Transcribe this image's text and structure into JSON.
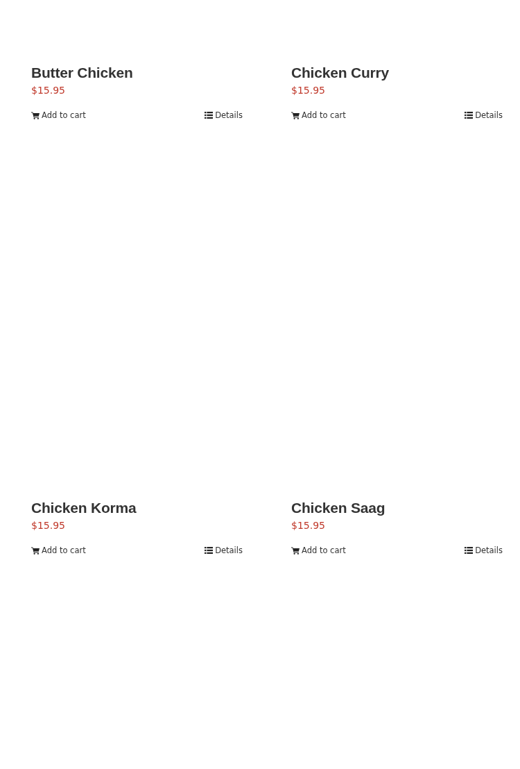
{
  "products": [
    {
      "name": "Butter Chicken",
      "price": "$15.95",
      "add_to_cart": "Add to cart",
      "details": "Details"
    },
    {
      "name": "Chicken Curry",
      "price": "$15.95",
      "add_to_cart": "Add to cart",
      "details": "Details"
    },
    {
      "name": "Chicken Korma",
      "price": "$15.95",
      "add_to_cart": "Add to cart",
      "details": "Details"
    },
    {
      "name": "Chicken Saag",
      "price": "$15.95",
      "add_to_cart": "Add to cart",
      "details": "Details"
    }
  ]
}
